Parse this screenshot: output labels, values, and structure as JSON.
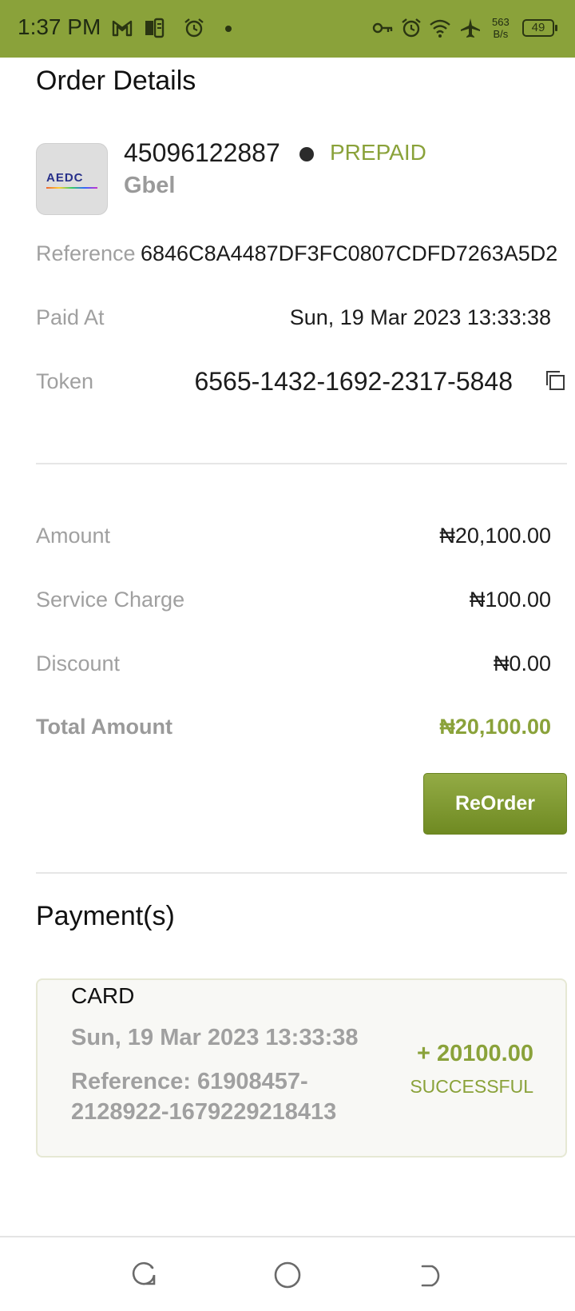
{
  "status_bar": {
    "time": "1:37 PM",
    "net_rate_value": "563",
    "net_rate_unit": "B/s",
    "battery": "49",
    "icons": [
      "gmail-icon",
      "notes-icon",
      "alarm-icon",
      "vpn-key-icon",
      "alarm-icon",
      "wifi-icon",
      "airplane-icon",
      "battery-icon"
    ]
  },
  "order": {
    "title": "Order Details",
    "meter_number": "45096122887",
    "meter_type": "PREPAID",
    "provider": "Gbel",
    "provider_logo_text": "AEDC",
    "reference_label": "Reference",
    "reference_value": "6846C8A4487DF3FC0807CDFD7263A5D2",
    "paid_at_label": "Paid At",
    "paid_at_value": "Sun, 19 Mar 2023 13:33:38",
    "token_label": "Token",
    "token_value": "6565-1432-1692-2317-5848"
  },
  "summary": {
    "amount_label": "Amount",
    "amount_value": "₦20,100.00",
    "service_charge_label": "Service Charge",
    "service_charge_value": "₦100.00",
    "discount_label": "Discount",
    "discount_value": "₦0.00",
    "total_label": "Total Amount",
    "total_value": "₦20,100.00",
    "reorder_label": "ReOrder"
  },
  "payments": {
    "title": "Payment(s)",
    "items": [
      {
        "method": "CARD",
        "date": "Sun, 19 Mar 2023 13:33:38",
        "reference": "Reference: 61908457-2128922-1679229218413",
        "amount": "+ 20100.00",
        "status": "SUCCESSFUL"
      }
    ]
  },
  "colors": {
    "accent": "#8aa23a",
    "status_bar": "#8aa23a",
    "label_gray": "#a0a0a0"
  }
}
